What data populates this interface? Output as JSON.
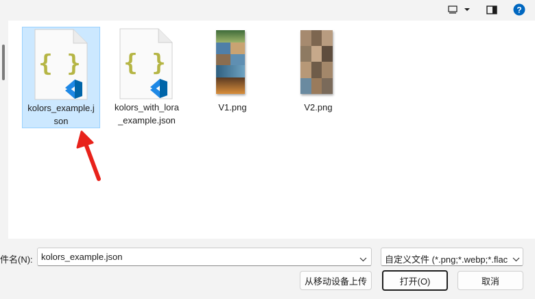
{
  "files": [
    {
      "name_line1": "kolors_example.j",
      "name_line2": "son",
      "icon": "vscode-json-file-icon",
      "selected": true
    },
    {
      "name_line1": "kolors_with_lora",
      "name_line2": "_example.json",
      "icon": "vscode-json-file-icon",
      "selected": false
    },
    {
      "name_line1": "V1.png",
      "name_line2": "",
      "icon": "image-thumbnail",
      "selected": false
    },
    {
      "name_line1": "V2.png",
      "name_line2": "",
      "icon": "image-thumbnail",
      "selected": false
    }
  ],
  "bottom": {
    "filename_label": "件名(N):",
    "filename_value": "kolors_example.json",
    "filter_text": "自定义文件 (*.png;*.webp;*.flac",
    "upload_button": "从移动设备上传",
    "open_button": "打开(O)",
    "cancel_button": "取消"
  },
  "toolbar": {
    "view_icon": "view-mode-icon",
    "dropdown_icon": "chevron-down-icon",
    "preview_pane_icon": "preview-pane-icon",
    "help_icon": "help-icon",
    "help_label": "?"
  },
  "colors": {
    "accent": "#0067c0",
    "selection_bg": "#cce8ff",
    "annotation_arrow": "#e8221b",
    "json_brace": "#b5b544",
    "vscode_blue": "#1e88e5"
  }
}
